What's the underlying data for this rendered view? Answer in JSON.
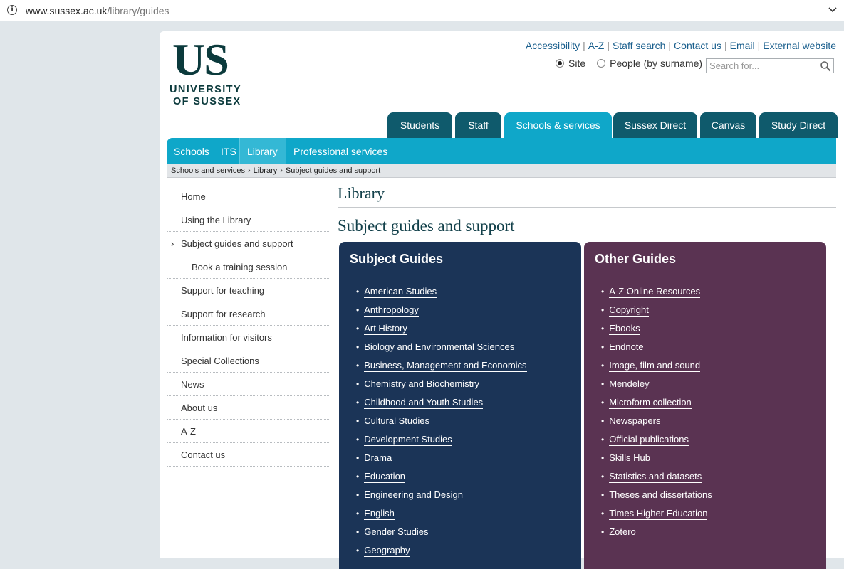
{
  "browser": {
    "url_host": "www.sussex.ac.uk",
    "url_path": "/library/guides"
  },
  "logo": {
    "mark": "US",
    "line1": "UNIVERSITY",
    "line2": "OF SUSSEX"
  },
  "utility_links": [
    "Accessibility",
    "A-Z",
    "Staff search",
    "Contact us",
    "Email",
    "External website"
  ],
  "search": {
    "options": [
      {
        "label": "Site",
        "selected": true
      },
      {
        "label": "People (by surname)",
        "selected": false
      }
    ],
    "placeholder": "Search for..."
  },
  "tabs": [
    {
      "label": "Students",
      "active": false
    },
    {
      "label": "Staff",
      "active": false
    },
    {
      "label": "Schools & services",
      "active": true
    },
    {
      "label": "Sussex Direct",
      "active": false
    },
    {
      "label": "Canvas",
      "active": false
    },
    {
      "label": "Study Direct",
      "active": false
    }
  ],
  "subnav": [
    {
      "label": "Schools",
      "active": false
    },
    {
      "label": "ITS",
      "active": false
    },
    {
      "label": "Library",
      "active": true
    },
    {
      "label": "Professional services",
      "active": false
    }
  ],
  "breadcrumb": [
    "Schools and services",
    "Library",
    "Subject guides and support"
  ],
  "leftnav": [
    {
      "label": "Home"
    },
    {
      "label": "Using the Library"
    },
    {
      "label": "Subject guides and support",
      "current": true
    },
    {
      "label": "Book a training session",
      "sub": true
    },
    {
      "label": "Support for teaching"
    },
    {
      "label": "Support for research"
    },
    {
      "label": "Information for visitors"
    },
    {
      "label": "Special Collections"
    },
    {
      "label": "News"
    },
    {
      "label": "About us"
    },
    {
      "label": "A-Z"
    },
    {
      "label": "Contact us"
    }
  ],
  "content": {
    "section_title": "Library",
    "page_title": "Subject guides and support"
  },
  "subject_guides": {
    "title": "Subject Guides",
    "items": [
      "American Studies",
      "Anthropology",
      "Art History",
      "Biology and Environmental Sciences",
      "Business, Management and Economics",
      "Chemistry and Biochemistry",
      "Childhood and Youth Studies",
      "Cultural Studies",
      "Development Studies",
      "Drama",
      "Education",
      "Engineering and Design",
      "English",
      "Gender Studies",
      "Geography"
    ]
  },
  "other_guides": {
    "title": "Other Guides",
    "items": [
      "A-Z Online Resources",
      "Copyright",
      "Ebooks",
      "Endnote",
      "Image, film and sound",
      "Mendeley",
      "Microform collection",
      "Newspapers",
      "Official publications",
      "Skills Hub",
      "Statistics and datasets",
      "Theses and dissertations",
      "Times Higher Education",
      "Zotero"
    ]
  },
  "colors": {
    "dark_teal": "#0f5a6c",
    "active_cyan": "#0fa7c9",
    "subject_panel": "#1b3457",
    "other_panel": "#5a3352",
    "link_blue": "#1a5f8d"
  }
}
